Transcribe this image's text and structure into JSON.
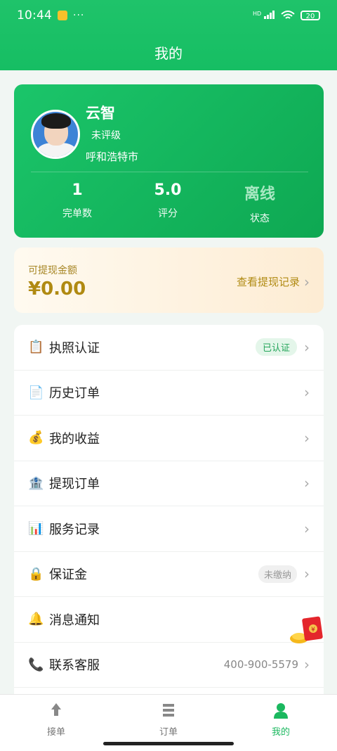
{
  "status_bar": {
    "time": "10:44",
    "more": "···",
    "hd": "HD",
    "battery": "20"
  },
  "header": {
    "title": "我的"
  },
  "profile": {
    "name": "云智",
    "level": "未评级",
    "city": "呼和浩特市",
    "stats": [
      {
        "value": "1",
        "label": "完单数"
      },
      {
        "value": "5.0",
        "label": "评分"
      },
      {
        "value": "离线",
        "label": "状态"
      }
    ]
  },
  "withdraw": {
    "label": "可提现金额",
    "amount": "¥0.00",
    "link": "查看提现记录"
  },
  "menu": [
    {
      "icon": "📋",
      "label": "执照认证",
      "badge": "已认证"
    },
    {
      "icon": "📄",
      "label": "历史订单"
    },
    {
      "icon": "💰",
      "label": "我的收益"
    },
    {
      "icon": "🏦",
      "label": "提现订单"
    },
    {
      "icon": "📊",
      "label": "服务记录"
    },
    {
      "icon": "🔒",
      "label": "保证金",
      "badge": "未缴纳"
    },
    {
      "icon": "🔔",
      "label": "消息通知"
    },
    {
      "icon": "📞",
      "label": "联系客服",
      "value": "400-900-5579"
    }
  ],
  "tabs": [
    {
      "label": "接单"
    },
    {
      "label": "订单"
    },
    {
      "label": "我的"
    }
  ],
  "colors": {
    "brand": "#1bc56a",
    "gold": "#b08a12"
  }
}
